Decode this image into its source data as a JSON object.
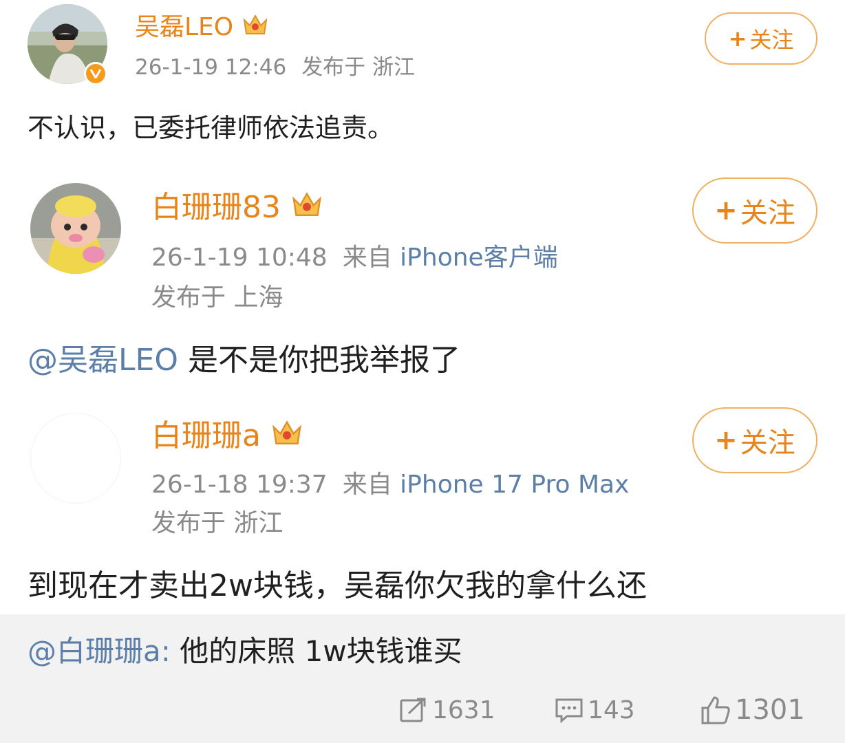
{
  "posts": [
    {
      "author": "吴磊LEO",
      "time": "26-1-19 12:46",
      "location": "发布于 浙江",
      "text": "不认识，已委托律师依法追责。",
      "follow_label": "关注"
    },
    {
      "author": "白珊珊83",
      "time": "26-1-19 10:48",
      "source_prefix": "来自",
      "source_client": "iPhone客户端",
      "location": "发布于 上海",
      "mention": "@吴磊LEO",
      "text": "是不是你把我举报了",
      "follow_label": "关注"
    },
    {
      "author": "白珊珊a",
      "time": "26-1-18 19:37",
      "source_prefix": "来自",
      "source_client": "iPhone 17 Pro Max",
      "location": "发布于 浙江",
      "text": "到现在才卖出2w块钱，吴磊你欠我的拿什么还",
      "follow_label": "关注"
    }
  ],
  "quote": {
    "mention": "@白珊珊a:",
    "text": "他的床照 1w块钱谁买"
  },
  "stats": {
    "reposts": "1631",
    "comments": "143",
    "likes": "1301"
  },
  "colors": {
    "name_orange": "#e8841a",
    "link_blue": "#5b7fa8",
    "follow_border": "#f0b062",
    "meta_gray": "#8a8a8a"
  }
}
